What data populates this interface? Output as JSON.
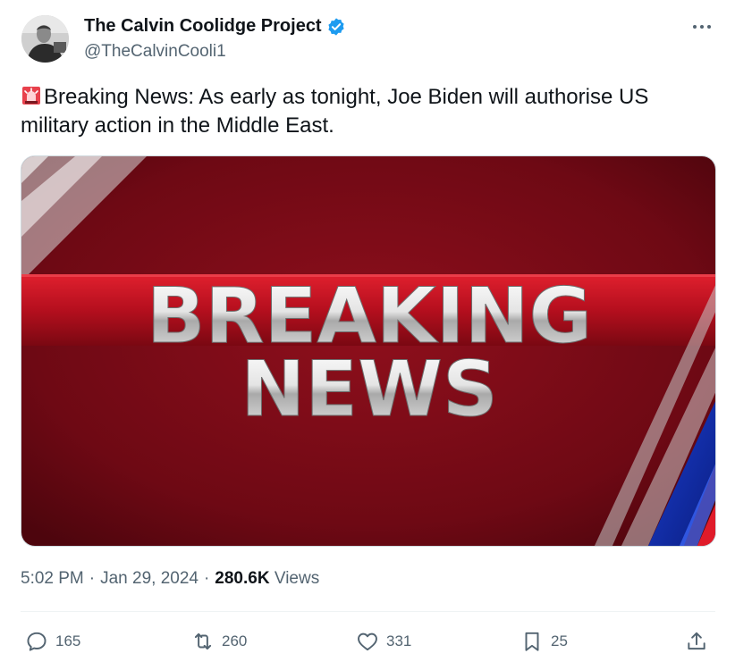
{
  "author": {
    "display_name": "The Calvin Coolidge Project",
    "handle": "@TheCalvinCooli1",
    "verified": true
  },
  "tweet": {
    "emoji_icon": "siren-icon",
    "text": "Breaking News: As early as tonight, Joe Biden will authorise US military action in the Middle East.",
    "media": {
      "line1": "BREAKING",
      "line2": "NEWS",
      "background_color": "#7a0a14",
      "band_color": "#c41222"
    }
  },
  "meta": {
    "time": "5:02 PM",
    "separator": "·",
    "date": "Jan 29, 2024",
    "views_count": "280.6K",
    "views_label": "Views"
  },
  "actions": {
    "replies": "165",
    "reposts": "260",
    "likes": "331",
    "bookmarks": "25"
  },
  "colors": {
    "text": "#0f1419",
    "secondary": "#536471",
    "verified": "#1d9bf0"
  }
}
